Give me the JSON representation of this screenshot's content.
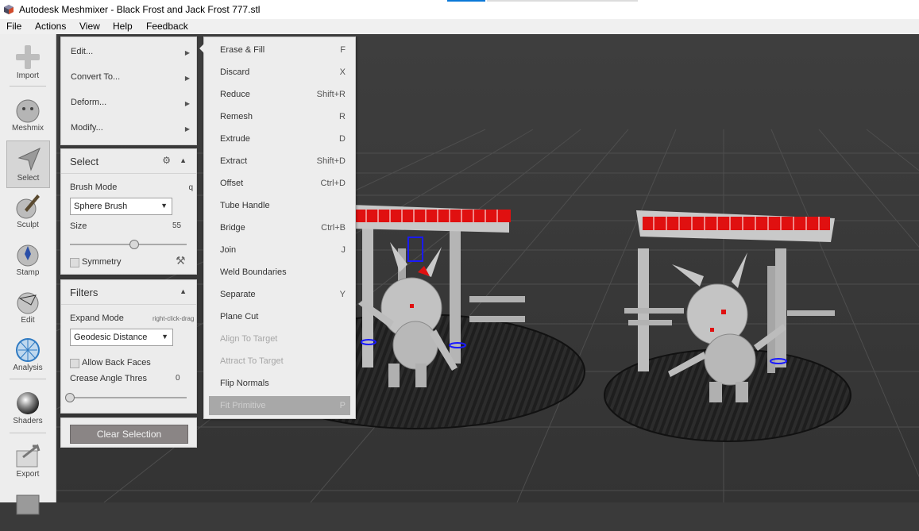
{
  "window": {
    "title": "Autodesk Meshmixer - Black Frost and Jack Frost 777.stl"
  },
  "menubar": [
    "File",
    "Actions",
    "View",
    "Help",
    "Feedback"
  ],
  "toolbar": {
    "tools": [
      "Import",
      "Meshmix",
      "Select",
      "Sculpt",
      "Stamp",
      "Edit",
      "Analysis",
      "Shaders",
      "Export"
    ],
    "active": "Select"
  },
  "actions_panel": {
    "items": [
      "Edit...",
      "Convert To...",
      "Deform...",
      "Modify..."
    ]
  },
  "select_panel": {
    "title": "Select",
    "brush_mode_label": "Brush Mode",
    "brush_mode_hotkey": "q",
    "brush_mode_value": "Sphere Brush",
    "size_label": "Size",
    "size_value": "55",
    "size_fraction": 0.55,
    "symmetry_label": "Symmetry"
  },
  "filters_panel": {
    "title": "Filters",
    "expand_mode_label": "Expand Mode",
    "expand_mode_hint": "right-click-drag",
    "expand_mode_value": "Geodesic Distance",
    "allow_back_faces_label": "Allow Back Faces",
    "crease_angle_label": "Crease Angle Thres",
    "crease_angle_value": "0",
    "crease_fraction": 0.0
  },
  "clear_selection_label": "Clear Selection",
  "edit_menu": {
    "items": [
      {
        "label": "Erase & Fill",
        "shortcut": "F",
        "enabled": true
      },
      {
        "label": "Discard",
        "shortcut": "X",
        "enabled": true
      },
      {
        "label": "Reduce",
        "shortcut": "Shift+R",
        "enabled": true
      },
      {
        "label": "Remesh",
        "shortcut": "R",
        "enabled": true
      },
      {
        "label": "Extrude",
        "shortcut": "D",
        "enabled": true
      },
      {
        "label": "Extract",
        "shortcut": "Shift+D",
        "enabled": true
      },
      {
        "label": "Offset",
        "shortcut": "Ctrl+D",
        "enabled": true
      },
      {
        "label": "Tube Handle",
        "shortcut": "",
        "enabled": true
      },
      {
        "label": "Bridge",
        "shortcut": "Ctrl+B",
        "enabled": true
      },
      {
        "label": "Join",
        "shortcut": "J",
        "enabled": true
      },
      {
        "label": "Weld Boundaries",
        "shortcut": "",
        "enabled": true
      },
      {
        "label": "Separate",
        "shortcut": "Y",
        "enabled": true
      },
      {
        "label": "Plane Cut",
        "shortcut": "",
        "enabled": true
      },
      {
        "label": "Align To Target",
        "shortcut": "",
        "enabled": false
      },
      {
        "label": "Attract To Target",
        "shortcut": "",
        "enabled": false
      },
      {
        "label": "Flip Normals",
        "shortcut": "",
        "enabled": true
      },
      {
        "label": "Fit Primitive",
        "shortcut": "P",
        "enabled": false,
        "hover": true
      }
    ]
  },
  "colors": {
    "viewport_bg": "#3b3b3b",
    "grid_line": "#4e4e4e",
    "selection_red": "#e01010",
    "boundary_blue": "#1a1aff",
    "model_grey": "#b9b9b9",
    "base_dark": "#1e1e1e"
  }
}
